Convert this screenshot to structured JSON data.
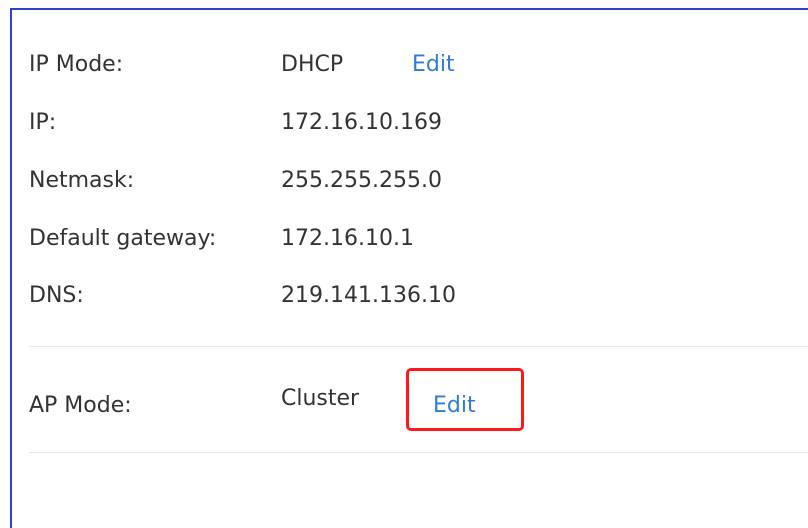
{
  "settings": {
    "ip_mode": {
      "label": "IP Mode:",
      "value": "DHCP",
      "edit_label": "Edit"
    },
    "ip": {
      "label": "IP:",
      "value": "172.16.10.169"
    },
    "netmask": {
      "label": "Netmask:",
      "value": "255.255.255.0"
    },
    "gateway": {
      "label": "Default gateway:",
      "value": "172.16.10.1"
    },
    "dns": {
      "label": "DNS:",
      "value": "219.141.136.10"
    },
    "ap_mode": {
      "label": "AP Mode:",
      "value": "Cluster",
      "edit_label": "Edit"
    }
  },
  "colors": {
    "link": "#2f7dd1",
    "frame_border": "#2f43c8",
    "highlight": "#ff1a1a",
    "text": "#333333"
  }
}
